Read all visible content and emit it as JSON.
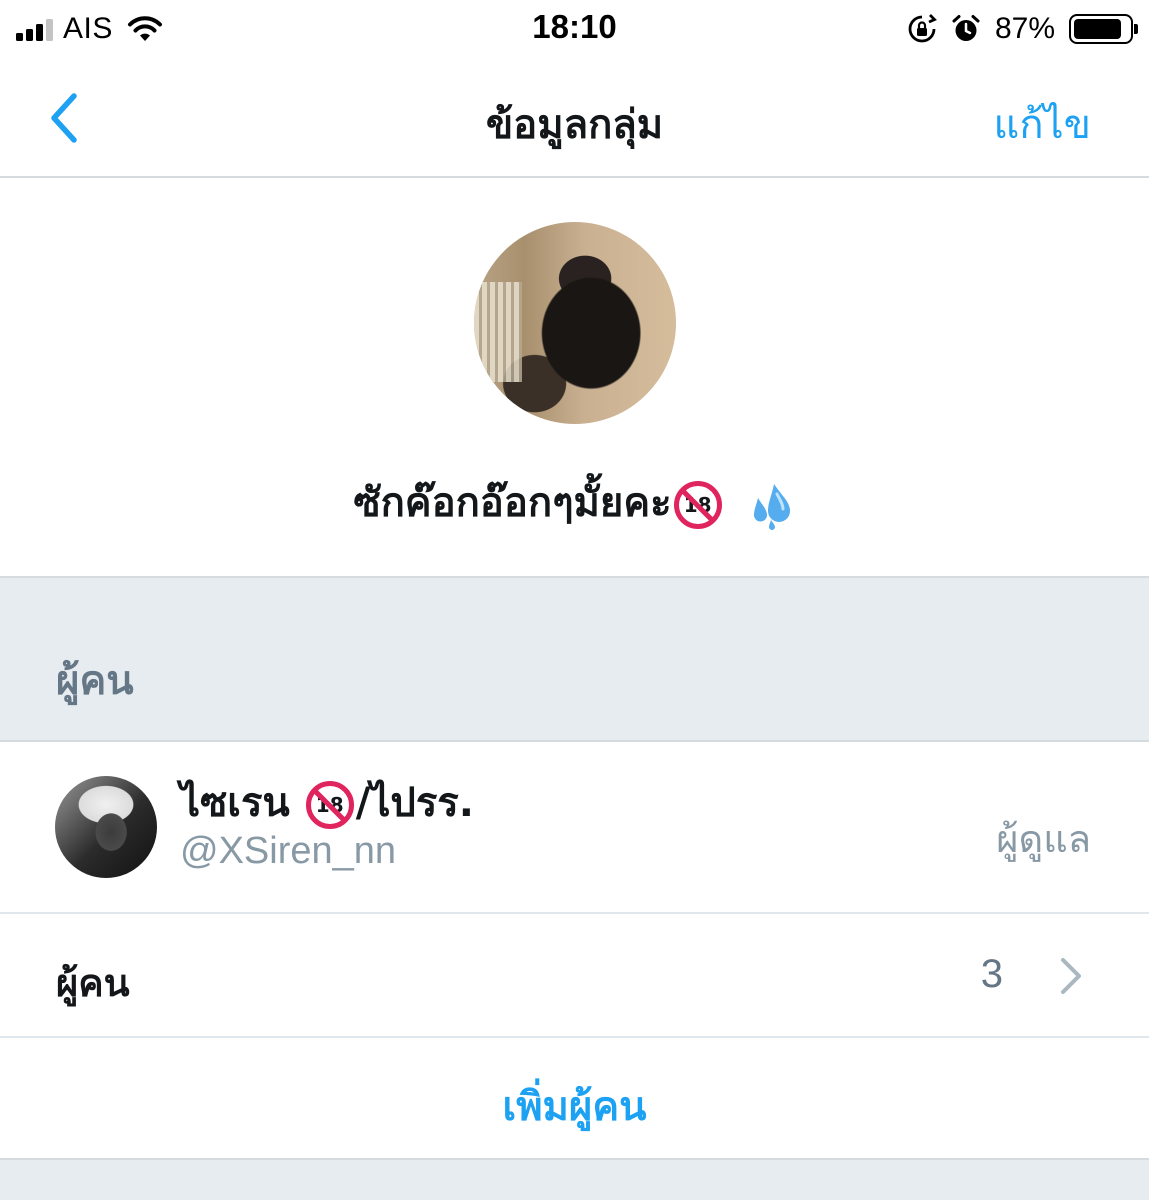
{
  "status_bar": {
    "carrier": "AIS",
    "time": "18:10",
    "battery_percent": "87%",
    "battery_level": 0.87,
    "icons": [
      "signal-icon",
      "wifi-icon",
      "orientation-lock-icon",
      "alarm-icon",
      "battery-icon"
    ]
  },
  "nav": {
    "title": "ข้อมูลกลุ่ม",
    "edit_label": "แก้ไข",
    "back_icon": "chevron-left-icon"
  },
  "group": {
    "name": "ซักค๊อกอ๊อกๆมั้ยคะ",
    "badge_text": "18",
    "emoji_icon": "sweat-droplets-icon"
  },
  "people_section": {
    "title": "ผู้คน"
  },
  "member": {
    "name": "ไซเรน",
    "name_suffix": "/ไปรร.",
    "badge_text": "18",
    "handle": "@XSiren_nn",
    "role": "ผู้ดูแล"
  },
  "people_row": {
    "label": "ผู้คน",
    "count": "3"
  },
  "add_people": {
    "label": "เพิ่มผู้คน"
  },
  "colors": {
    "accent": "#1da1f2",
    "section_bg": "#e6ecf0",
    "muted_text": "#8899a6",
    "badge_red": "#e0245e"
  }
}
